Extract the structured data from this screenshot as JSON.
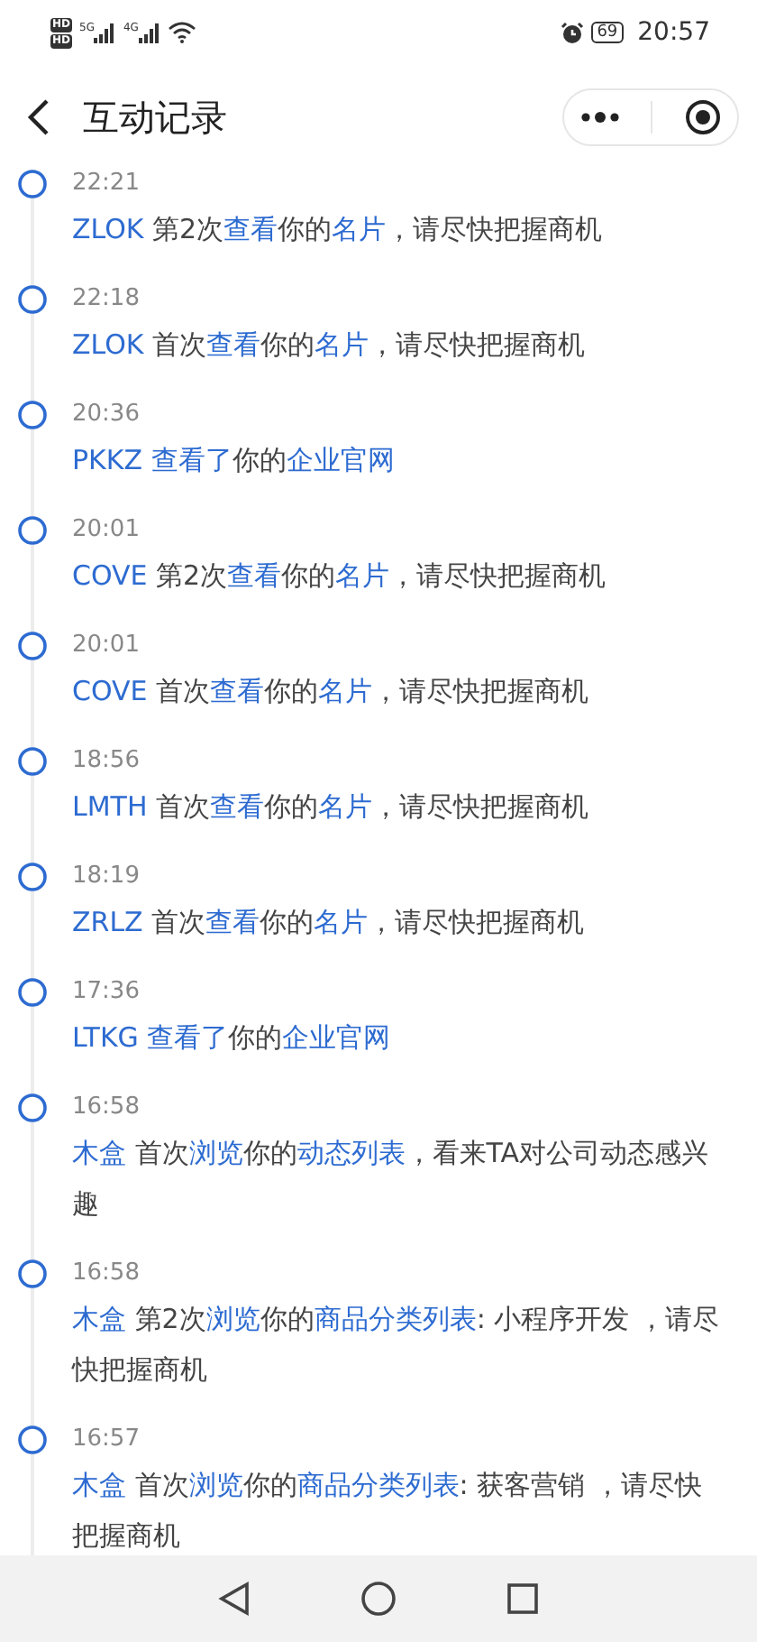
{
  "status_bar": {
    "hd": [
      "HD",
      "HD"
    ],
    "signals": [
      "5G",
      "4G"
    ],
    "battery": "69",
    "time": "20:57"
  },
  "header": {
    "title": "互动记录"
  },
  "events": [
    {
      "time": "22:21",
      "segments": [
        {
          "text": "ZLOK",
          "kind": "link"
        },
        {
          "text": " 第2次",
          "kind": "plain"
        },
        {
          "text": "查看",
          "kind": "link"
        },
        {
          "text": "你的",
          "kind": "plain"
        },
        {
          "text": "名片",
          "kind": "link"
        },
        {
          "text": "，请尽快把握商机",
          "kind": "plain"
        }
      ]
    },
    {
      "time": "22:18",
      "segments": [
        {
          "text": "ZLOK",
          "kind": "link"
        },
        {
          "text": " 首次",
          "kind": "plain"
        },
        {
          "text": "查看",
          "kind": "link"
        },
        {
          "text": "你的",
          "kind": "plain"
        },
        {
          "text": "名片",
          "kind": "link"
        },
        {
          "text": "，请尽快把握商机",
          "kind": "plain"
        }
      ]
    },
    {
      "time": "20:36",
      "segments": [
        {
          "text": "PKKZ",
          "kind": "link"
        },
        {
          "text": " 查看了",
          "kind": "link"
        },
        {
          "text": "你的",
          "kind": "plain"
        },
        {
          "text": "企业官网",
          "kind": "link"
        }
      ]
    },
    {
      "time": "20:01",
      "segments": [
        {
          "text": "COVE",
          "kind": "link"
        },
        {
          "text": " 第2次",
          "kind": "plain"
        },
        {
          "text": "查看",
          "kind": "link"
        },
        {
          "text": "你的",
          "kind": "plain"
        },
        {
          "text": "名片",
          "kind": "link"
        },
        {
          "text": "，请尽快把握商机",
          "kind": "plain"
        }
      ]
    },
    {
      "time": "20:01",
      "segments": [
        {
          "text": "COVE",
          "kind": "link"
        },
        {
          "text": " 首次",
          "kind": "plain"
        },
        {
          "text": "查看",
          "kind": "link"
        },
        {
          "text": "你的",
          "kind": "plain"
        },
        {
          "text": "名片",
          "kind": "link"
        },
        {
          "text": "，请尽快把握商机",
          "kind": "plain"
        }
      ]
    },
    {
      "time": "18:56",
      "segments": [
        {
          "text": "LMTH",
          "kind": "link"
        },
        {
          "text": " 首次",
          "kind": "plain"
        },
        {
          "text": "查看",
          "kind": "link"
        },
        {
          "text": "你的",
          "kind": "plain"
        },
        {
          "text": "名片",
          "kind": "link"
        },
        {
          "text": "，请尽快把握商机",
          "kind": "plain"
        }
      ]
    },
    {
      "time": "18:19",
      "segments": [
        {
          "text": "ZRLZ",
          "kind": "link"
        },
        {
          "text": " 首次",
          "kind": "plain"
        },
        {
          "text": "查看",
          "kind": "link"
        },
        {
          "text": "你的",
          "kind": "plain"
        },
        {
          "text": "名片",
          "kind": "link"
        },
        {
          "text": "，请尽快把握商机",
          "kind": "plain"
        }
      ]
    },
    {
      "time": "17:36",
      "segments": [
        {
          "text": "LTKG",
          "kind": "link"
        },
        {
          "text": " 查看了",
          "kind": "link"
        },
        {
          "text": "你的",
          "kind": "plain"
        },
        {
          "text": "企业官网",
          "kind": "link"
        }
      ]
    },
    {
      "time": "16:58",
      "segments": [
        {
          "text": "木盒",
          "kind": "link"
        },
        {
          "text": " 首次",
          "kind": "plain"
        },
        {
          "text": "浏览",
          "kind": "link"
        },
        {
          "text": "你的",
          "kind": "plain"
        },
        {
          "text": "动态列表",
          "kind": "link"
        },
        {
          "text": "，看来TA对公司动态感兴趣",
          "kind": "plain"
        }
      ]
    },
    {
      "time": "16:58",
      "segments": [
        {
          "text": "木盒",
          "kind": "link"
        },
        {
          "text": " 第2次",
          "kind": "plain"
        },
        {
          "text": "浏览",
          "kind": "link"
        },
        {
          "text": "你的",
          "kind": "plain"
        },
        {
          "text": "商品分类列表",
          "kind": "link"
        },
        {
          "text": ": 小程序开发 ，请尽快把握商机",
          "kind": "plain"
        }
      ]
    },
    {
      "time": "16:57",
      "segments": [
        {
          "text": "木盒",
          "kind": "link"
        },
        {
          "text": " 首次",
          "kind": "plain"
        },
        {
          "text": "浏览",
          "kind": "link"
        },
        {
          "text": "你的",
          "kind": "plain"
        },
        {
          "text": "商品分类列表",
          "kind": "link"
        },
        {
          "text": ": 获客营销 ，请尽快把握商机",
          "kind": "plain"
        }
      ]
    }
  ]
}
